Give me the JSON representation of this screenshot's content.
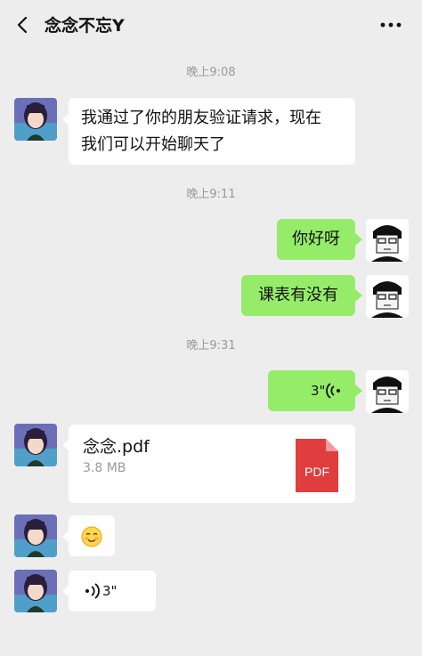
{
  "header": {
    "title": "念念不忘Y",
    "back_icon": "back-chevron-icon",
    "more_icon": "more-dots-icon"
  },
  "messages": {
    "time1": "晚上9:08",
    "msg1_line1": "我通过了你的朋友验证请求，现在",
    "msg1_line2": "我们可以开始聊天了",
    "time2": "晚上9:11",
    "msg2": "你好呀",
    "msg3": "课表有没有",
    "time3": "晚上9:31",
    "voice_out_duration": "3\"",
    "file_name": "念念.pdf",
    "file_size": "3.8 MB",
    "file_icon_label": "PDF",
    "emoji": "smiling-face-emoji",
    "voice_in_duration": "3\""
  },
  "colors": {
    "background": "#ededed",
    "incoming_bubble": "#ffffff",
    "outgoing_bubble": "#95ec69",
    "timestamp": "#9a9a9a",
    "pdf_red": "#e03e3e"
  }
}
